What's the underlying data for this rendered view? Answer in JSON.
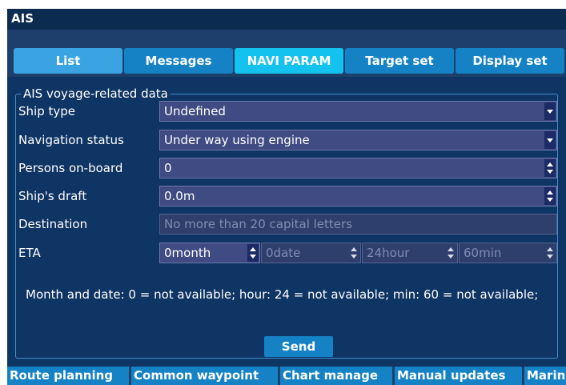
{
  "window": {
    "title": "AIS"
  },
  "tabs": [
    {
      "label": "List"
    },
    {
      "label": "Messages"
    },
    {
      "label": "NAVI PARAM"
    },
    {
      "label": "Target set"
    },
    {
      "label": "Display set"
    }
  ],
  "active_tab": "NAVI PARAM",
  "group": {
    "title": "AIS voyage-related data",
    "ship_type": {
      "label": "Ship type",
      "value": "Undefined"
    },
    "nav_status": {
      "label": "Navigation status",
      "value": "Under way using engine"
    },
    "persons": {
      "label": "Persons on-board",
      "value": "0"
    },
    "draft": {
      "label": "Ship's draft",
      "value": "0.0m"
    },
    "destination": {
      "label": "Destination",
      "placeholder": "No more than 20 capital letters"
    },
    "eta": {
      "label": "ETA",
      "month": "0month",
      "date": "0date",
      "hour": "24hour",
      "min": "60min"
    },
    "note": "Month and date: 0 = not available; hour: 24 = not available; min: 60 = not available;",
    "send_label": "Send"
  },
  "bottom_tabs": [
    {
      "label": "Route planning"
    },
    {
      "label": "Common waypoint"
    },
    {
      "label": "Chart manage"
    },
    {
      "label": "Manual updates"
    },
    {
      "label": "Marin"
    }
  ],
  "colors": {
    "titlebar": "#0b2b50",
    "panel": "#0f3564",
    "tab": "#1582c6",
    "tab_active": "#13c2ee",
    "field": "#3f4b82",
    "group_border": "#3d8fd0"
  }
}
